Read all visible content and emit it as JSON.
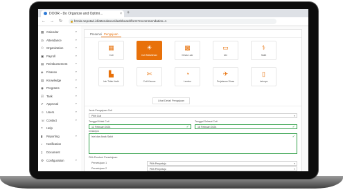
{
  "browser": {
    "tab_title": "DOOR - Do Organize and Optimi...",
    "tab_close": "×",
    "new_tab": "+",
    "nav_back": "←",
    "nav_forward": "→",
    "nav_reload": "↻",
    "url": "hrmis.nepotari.id/attendance/dashboard/form?recommendation=1",
    "lock_glyph": "🔒"
  },
  "sidebar": {
    "items": [
      {
        "label": "Calendar",
        "icon": "calendar-icon",
        "glyph": "▦",
        "chevron": "▾"
      },
      {
        "label": "Attendance",
        "icon": "clock-icon",
        "glyph": "◷",
        "chevron": "▾"
      },
      {
        "label": "Organization",
        "icon": "org-icon",
        "glyph": "⚇",
        "chevron": "▾"
      },
      {
        "label": "Payroll",
        "icon": "wallet-icon",
        "glyph": "▣",
        "chevron": "▾"
      },
      {
        "label": "Reimbursement",
        "icon": "receipt-icon",
        "glyph": "▤",
        "chevron": "▾"
      },
      {
        "label": "Finance",
        "icon": "finance-icon",
        "glyph": "◈",
        "chevron": "▾"
      },
      {
        "label": "Knowledge",
        "icon": "book-icon",
        "glyph": "▥",
        "chevron": "▾"
      },
      {
        "label": "Programs",
        "icon": "program-icon",
        "glyph": "◉",
        "chevron": "▾"
      },
      {
        "label": "Task",
        "icon": "task-icon",
        "glyph": "☑",
        "chevron": "▾"
      },
      {
        "label": "Approval",
        "icon": "approval-icon",
        "glyph": "✔",
        "chevron": "▾"
      },
      {
        "label": "Users",
        "icon": "users-icon",
        "glyph": "☺",
        "chevron": "▾"
      },
      {
        "label": "Contact",
        "icon": "contact-icon",
        "glyph": "☏",
        "chevron": "▾"
      },
      {
        "label": "Help",
        "icon": "help-icon",
        "glyph": "?",
        "chevron": ""
      },
      {
        "label": "Reporting",
        "icon": "report-icon",
        "glyph": "▮",
        "chevron": "▾"
      },
      {
        "label": "Notification",
        "icon": "bell-icon",
        "glyph": "♪",
        "chevron": ""
      },
      {
        "label": "Document",
        "icon": "document-icon",
        "glyph": "▯",
        "chevron": ""
      },
      {
        "label": "Configuration",
        "icon": "gear-icon",
        "glyph": "⚙",
        "chevron": "▾"
      }
    ]
  },
  "content": {
    "tabs": [
      {
        "label": "Presensi",
        "active": false
      },
      {
        "label": "Pengajuan",
        "active": true
      }
    ],
    "tiles": [
      {
        "label": "Cuti",
        "icon": "calendar-icon",
        "glyph": "▦",
        "selected": false
      },
      {
        "label": "Cuti Melahirkan",
        "icon": "sun-icon",
        "glyph": "☀",
        "selected": true
      },
      {
        "label": "Dinas Luar",
        "icon": "briefcase-icon",
        "glyph": "▩",
        "selected": false
      },
      {
        "label": "Izin",
        "icon": "clipboard-icon",
        "glyph": "▭",
        "selected": false
      },
      {
        "label": "Sakit",
        "icon": "pill-icon",
        "glyph": "⚕",
        "selected": false
      },
      {
        "label": "Izin Tidak Hadir",
        "icon": "car-icon",
        "glyph": "▙",
        "selected": false
      },
      {
        "label": "Cuti Khusus",
        "icon": "scissors-icon",
        "glyph": "✄",
        "selected": false
      },
      {
        "label": "Lembur",
        "icon": "timer-icon",
        "glyph": "◔",
        "selected": false
      },
      {
        "label": "Perjalanan Dinas",
        "icon": "plane-icon",
        "glyph": "✈",
        "selected": false
      },
      {
        "label": "Lainnya",
        "icon": "document-icon",
        "glyph": "▯",
        "selected": false
      }
    ],
    "info_button": "Lihat Detail Pengajuan"
  },
  "form": {
    "type_label": "Jenis Pengajuan Cuti",
    "type_value": "Pilih Cuti",
    "start_label": "Tanggal Mulai Cuti",
    "start_value": "12 Februari 2024",
    "end_label": "Tanggal Selesai Cuti",
    "end_value": "18 Februari 2024",
    "desc_label": "Deskripsi",
    "desc_value": "Istri dan Anak Sakit",
    "approver_label": "Pilih Pemberi Persetujuan",
    "approver1_label": "Persetujuan 1",
    "approver1_value": "Pilih Penyetuju",
    "approver2_label": "Persetujuan 2",
    "approver2_value": "Pilih Penyetuju",
    "check_glyph": "✓",
    "dd_glyph": "▾"
  },
  "colors": {
    "accent": "#e8710a",
    "success": "#2e9e46"
  }
}
